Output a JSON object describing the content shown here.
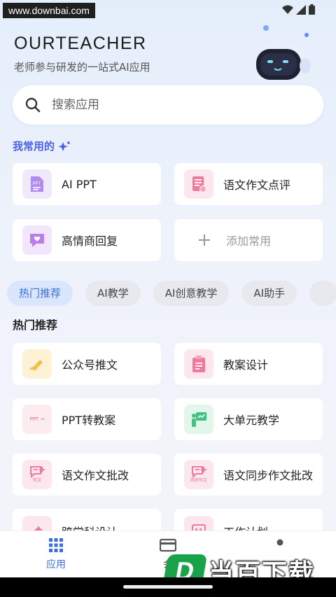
{
  "watermark_top": "www.downbai.com",
  "header": {
    "brand": "OURTEACHER",
    "tagline": "老师参与研发的一站式AI应用"
  },
  "search": {
    "placeholder": "搜索应用"
  },
  "favorites": {
    "title": "我常用的",
    "items": [
      {
        "label": "AI PPT",
        "icon": "ppt-doc-icon"
      },
      {
        "label": "语文作文点评",
        "icon": "essay-review-icon"
      },
      {
        "label": "高情商回复",
        "icon": "chat-heart-icon"
      },
      {
        "label": "添加常用",
        "icon": "plus-icon"
      }
    ]
  },
  "tabs": [
    "热门推荐",
    "AI教学",
    "AI创意教学",
    "AI助手"
  ],
  "hot": {
    "title": "热门推荐",
    "items": [
      {
        "label": "公众号推文",
        "icon": "pen-write-icon"
      },
      {
        "label": "教案设计",
        "icon": "clipboard-icon"
      },
      {
        "label": "PPT转教案",
        "icon": "ppt-to-plan-icon",
        "icon_text": "PPT →"
      },
      {
        "label": "大单元教学",
        "icon": "teacher-board-icon"
      },
      {
        "label": "语文作文批改",
        "icon": "essay-correct-icon",
        "icon_text": "作文"
      },
      {
        "label": "语文同步作文批改",
        "icon": "sync-essay-icon",
        "icon_text": "同步作文"
      },
      {
        "label": "跨学科设计",
        "icon": "eraser-icon"
      },
      {
        "label": "工作计划",
        "icon": "calendar-icon"
      }
    ]
  },
  "bottom_nav": {
    "items": [
      {
        "label": "应用",
        "icon": "grid-apps-icon"
      },
      {
        "label": "会",
        "icon": "card-icon"
      },
      {
        "label": "",
        "icon": "user-icon"
      }
    ]
  },
  "watermark_logo": {
    "badge": "D",
    "text": "当百下载"
  },
  "colors": {
    "accent": "#3b6fd8",
    "favorites_title": "#4b62e8",
    "watermark_green": "#18a24a"
  }
}
